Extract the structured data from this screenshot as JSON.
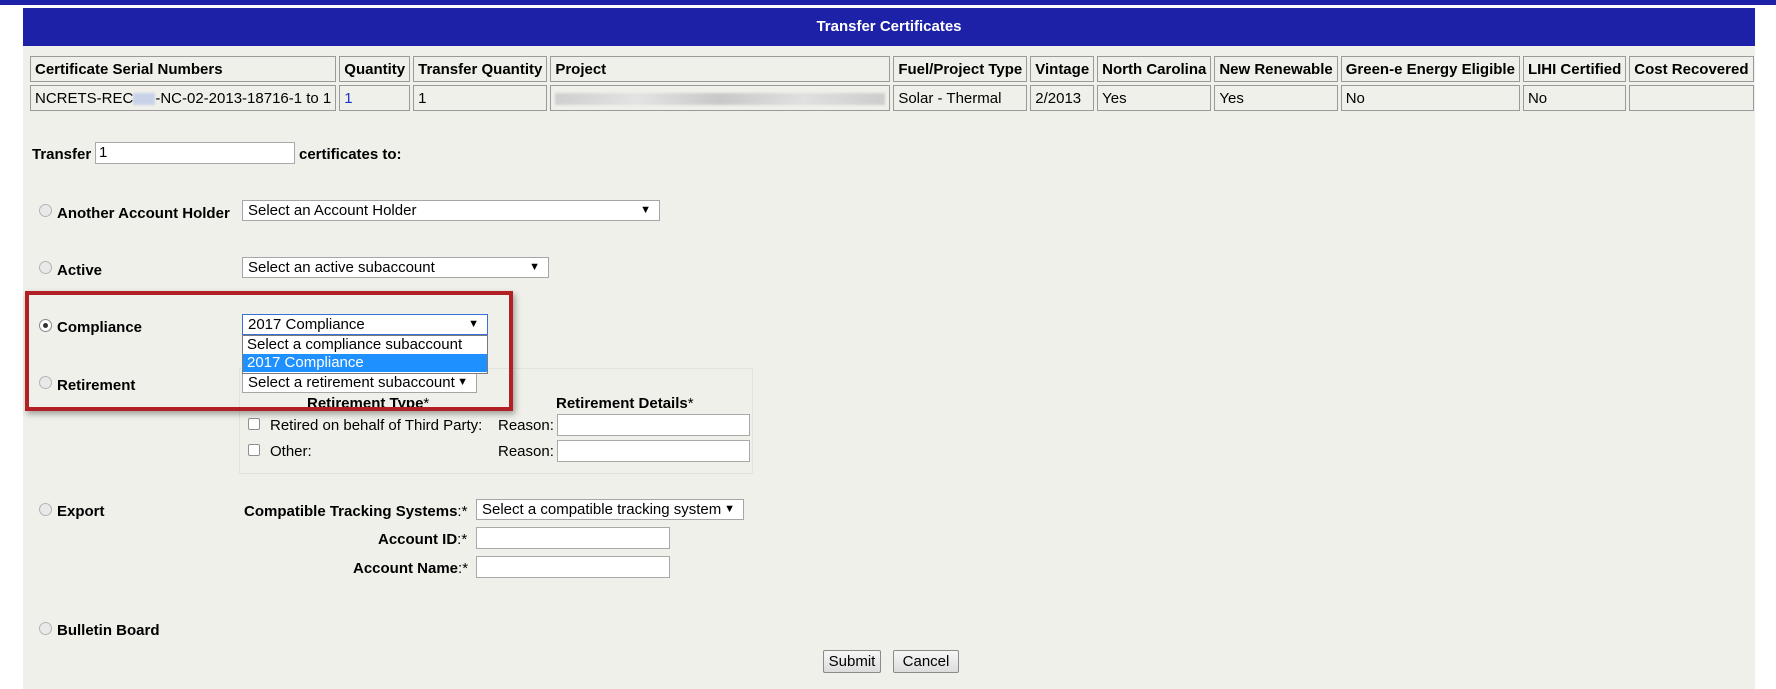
{
  "title": "Transfer Certificates",
  "table": {
    "headers": [
      "Certificate Serial Numbers",
      "Quantity",
      "Transfer Quantity",
      "Project",
      "Fuel/Project Type",
      "Vintage",
      "North Carolina",
      "New Renewable",
      "Green-e Energy Eligible",
      "LIHI Certified",
      "Cost Recovered"
    ],
    "row": {
      "serial_prefix": "NCRETS-REC",
      "serial_suffix": "-NC-02-2013-18716-1 to 1",
      "quantity": "1",
      "transfer_quantity": "1",
      "project": "",
      "fuel_type": "Solar - Thermal",
      "vintage": "2/2013",
      "north_carolina": "Yes",
      "new_renewable": "Yes",
      "green_e": "No",
      "lihi": "No",
      "cost_recovered": ""
    }
  },
  "transfer": {
    "label": "Transfer",
    "value": "1",
    "suffix": "certificates to:"
  },
  "options": {
    "another_account_holder": {
      "label": "Another Account Holder",
      "select": "Select an Account Holder"
    },
    "active": {
      "label": "Active",
      "select": "Select an active subaccount"
    },
    "compliance": {
      "label": "Compliance",
      "select": "2017 Compliance",
      "dropdown": [
        "Select a compliance subaccount",
        "2017 Compliance"
      ]
    },
    "retirement": {
      "label": "Retirement",
      "select": "Select a retirement subaccount",
      "type_header": "Retirement Type",
      "details_header": "Retirement Details",
      "required_mark": "*",
      "third_party": "Retired on behalf of Third Party:",
      "other": "Other:",
      "reason": "Reason:"
    },
    "export": {
      "label": "Export",
      "systems_label": "Compatible Tracking Systems",
      "systems_select": "Select a compatible tracking system",
      "account_id_label": "Account ID",
      "account_name_label": "Account Name",
      "required_mark": ":*"
    },
    "bulletin_board": {
      "label": "Bulletin Board"
    }
  },
  "buttons": {
    "submit": "Submit",
    "cancel": "Cancel"
  }
}
